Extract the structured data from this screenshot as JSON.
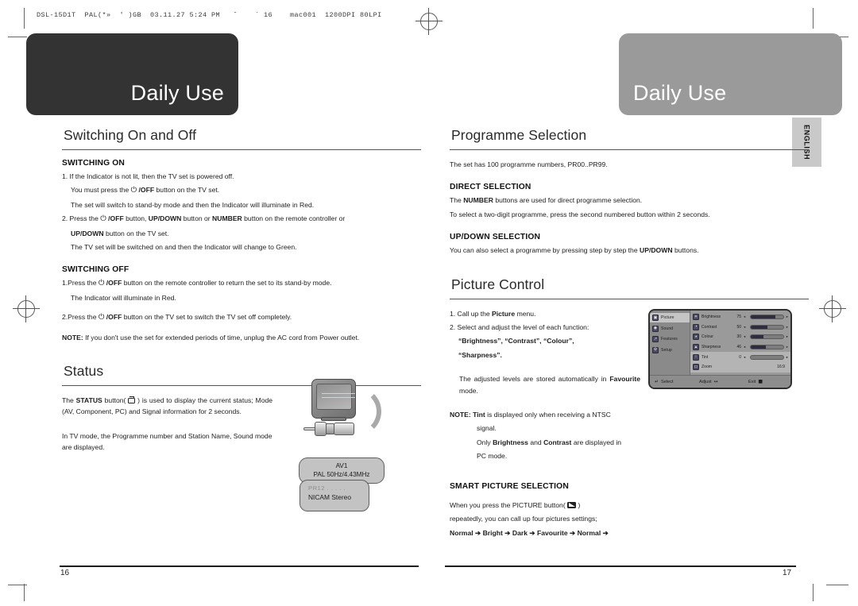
{
  "slug": "DSL-15D1T  PAL(*»  ' )GB  03.11.27 5:24 PM   ˘    ` 16    mac001  1200DPI 80LPI",
  "banners": {
    "left_title": "Daily Use",
    "right_title": "Daily Use"
  },
  "language_tab": "ENGLISH",
  "left_page": {
    "section1": {
      "heading": "Switching On and Off",
      "sub1": {
        "heading": "SWITCHING ON",
        "l1": "1. If the Indicator is not lit, then the TV set is powered off.",
        "l2a": "You must press the",
        "l2b": "/OFF",
        "l2c": "button on the TV set.",
        "l3": "The set will switch to stand-by mode and then the Indicator will illuminate in Red.",
        "l4a": "2. Press the",
        "l4b": "/OFF",
        "l4c": "button,",
        "l4d": "UP/DOWN",
        "l4e": "button or",
        "l4f": "NUMBER",
        "l4g": "button on the remote controller or",
        "l5a": "UP/DOWN",
        "l5b": "button on the TV set.",
        "l6": "The TV set will be switched on and then the Indicator  will change to Green."
      },
      "sub2": {
        "heading": "SWITCHING OFF",
        "l1a": "1.Press the",
        "l1b": "/OFF",
        "l1c": "button on the remote controller to return the set to its stand-by mode.",
        "l2": "The Indicator will illuminate in Red.",
        "l3a": "2.Press the",
        "l3b": "/OFF",
        "l3c": "button on the TV set to switch the TV set off completely.",
        "note_label": "NOTE:",
        "note_text": "If you don't use the set for extended periods of time, unplug the AC cord from Power outlet."
      }
    },
    "section2": {
      "heading": "Status",
      "p1a": "The",
      "p1b": "STATUS",
      "p1c": "button(",
      "p1d": ") is used to display the current status; Mode (AV, Component, PC) and Signal information for 2 seconds.",
      "p2": "In TV mode, the Programme number and Station Name, Sound mode are displayed."
    },
    "av_badge": {
      "line1": "AV1",
      "line2": "PAL 50Hz/4.43MHz"
    },
    "tv_badge": {
      "line1": "PR12  . . . . .",
      "line2": "NICAM  Stereo"
    },
    "page_number": "16"
  },
  "right_page": {
    "section1": {
      "heading": "Programme Selection",
      "intro": "The set has 100 programme numbers, PR00..PR99.",
      "sub1": {
        "heading": "DIRECT SELECTION",
        "l1a": "The",
        "l1b": "NUMBER",
        "l1c": "buttons are used for direct programme selection.",
        "l2": "To select  a two-digit programme, press the second numbered button within 2 seconds."
      },
      "sub2": {
        "heading": "UP/DOWN SELECTION",
        "l1a": "You can also select a programme by pressing step by step the",
        "l1b": "UP/DOWN",
        "l1c": "buttons."
      }
    },
    "section2": {
      "heading": "Picture Control",
      "step1a": "1. Call up the",
      "step1b": "Picture",
      "step1c": "menu.",
      "step2": "2. Select and adjust the level of each function:",
      "step2_list1": "“Brightness”, “Contrast”, “Colour”,",
      "step2_list2": "“Sharpness”.",
      "stored_a": "The adjusted levels are stored automatically in",
      "stored_b": "Favourite",
      "stored_c": "mode.",
      "note_label": "NOTE:",
      "note_b": "Tint",
      "note_1": "is displayed only when receiving a NTSC",
      "note_2": "signal.",
      "note_3a": "Only",
      "note_3b": "Brightness",
      "note_3c": "and",
      "note_3d": "Contrast",
      "note_3e": "are displayed in",
      "note_4": "PC mode."
    },
    "section3": {
      "heading": "SMART PICTURE SELECTION",
      "l1a": "When you press the PICTURE button(",
      "l1b": ")",
      "l2": "repeatedly, you can call up four pictures settings;",
      "l3": "Normal ➔ Bright ➔ Dark ➔ Favourite ➔ Normal ➔"
    },
    "page_number": "17"
  },
  "osd": {
    "tabs": [
      {
        "label": "Picture",
        "icon": "picture-icon",
        "glyph": "▣",
        "active": true
      },
      {
        "label": "Sound",
        "icon": "sound-icon",
        "glyph": "◉",
        "active": false
      },
      {
        "label": "Features",
        "icon": "features-icon",
        "glyph": "↗",
        "active": false
      },
      {
        "label": "Setup",
        "icon": "setup-icon",
        "glyph": "⚙",
        "active": false
      }
    ],
    "rows": [
      {
        "label": "Brightness",
        "value": "75",
        "icon": "brightness-icon",
        "glyph": "☀",
        "fill": 75
      },
      {
        "label": "Contrast",
        "value": "50",
        "icon": "contrast-icon",
        "glyph": "◑",
        "fill": 50
      },
      {
        "label": "Colour",
        "value": "30",
        "icon": "colour-icon",
        "glyph": "◕",
        "fill": 38
      },
      {
        "label": "Sharpness",
        "value": "46",
        "icon": "sharpness-icon",
        "glyph": "▲",
        "fill": 46
      },
      {
        "label": "Tint",
        "value": "0",
        "icon": "tint-icon",
        "glyph": "↕",
        "fill": 0
      }
    ],
    "zoom_row": {
      "label": "Zoom",
      "value": "16:9",
      "icon": "zoom-icon",
      "glyph": "▭"
    },
    "footer": {
      "select": "Select",
      "adjust": "Adjust",
      "exit": "Exit"
    }
  }
}
